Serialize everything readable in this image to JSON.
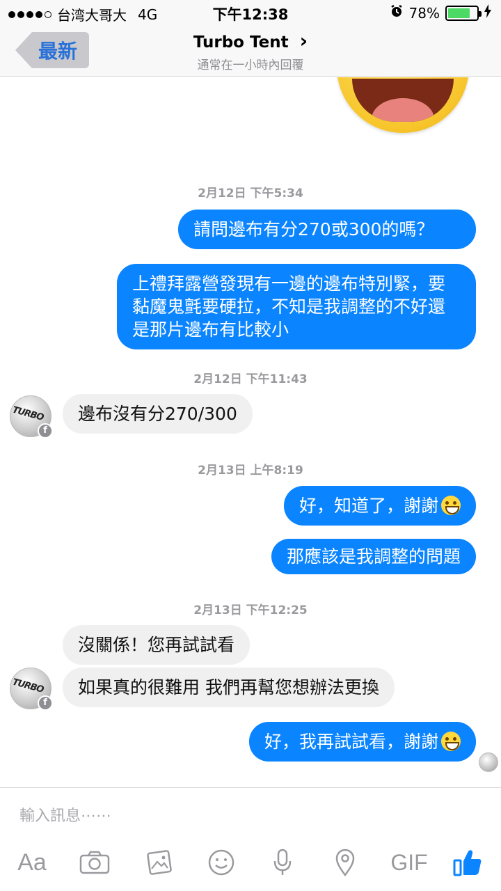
{
  "status_bar": {
    "carrier": "台湾大哥大",
    "network": "4G",
    "time": "下午12:38",
    "battery_percent": "78%",
    "battery_level": 0.78
  },
  "header": {
    "back_label": "最新",
    "title": "Turbo Tent",
    "title_chevron": "›",
    "subtitle": "通常在一小時內回覆"
  },
  "messages": {
    "ts1": "2月12日 下午5:34",
    "m1": "請問邊布有分270或300的嗎？",
    "m2": "上禮拜露營發現有一邊的邊布特別緊，要黏魔鬼氈要硬拉，不知是我調整的不好還是那片邊布有比較小",
    "ts2": "2月12日 下午11:43",
    "m3": "邊布沒有分270/300",
    "ts3": "2月13日 上午8:19",
    "m4": "好，知道了，謝謝",
    "m5": "那應該是我調整的問題",
    "ts4": "2月13日 下午12:25",
    "m6": "沒關係！您再試試看",
    "m7": "如果真的很難用 我們再幫您想辦法更換",
    "m8": "好，我再試試看，謝謝"
  },
  "avatar": {
    "logo": "TURBO"
  },
  "composer": {
    "placeholder": "輸入訊息⋯⋯",
    "aa_label": "Aa",
    "gif_label": "GIF",
    "icons": [
      "text-format-icon",
      "camera-icon",
      "photo-icon",
      "emoji-icon",
      "microphone-icon",
      "location-icon",
      "gif-icon",
      "like-icon"
    ]
  },
  "colors": {
    "outgoing_bubble": "#0a84ff",
    "incoming_bubble": "#f0f0f0",
    "like_blue": "#0a84ff"
  }
}
